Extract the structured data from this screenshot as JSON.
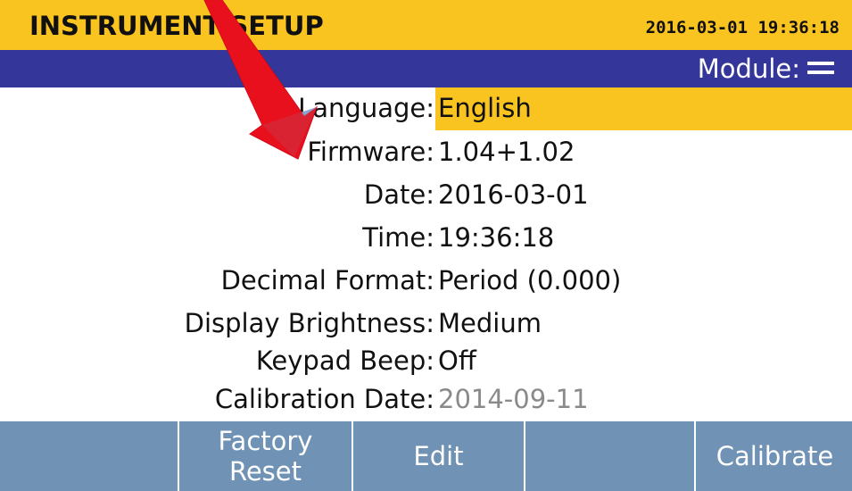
{
  "header": {
    "title": "INSTRUMENT SETUP",
    "datetime": "2016-03-01 19:36:18",
    "module_label": "Module:"
  },
  "settings": [
    {
      "label": "Language:",
      "value": "English",
      "selected": true
    },
    {
      "label": "Firmware:",
      "value": "1.04+1.02"
    },
    {
      "label": "Date:",
      "value": "2016-03-01"
    },
    {
      "label": "Time:",
      "value": "19:36:18"
    },
    {
      "label": "Decimal Format:",
      "value": "Period (0.000)"
    },
    {
      "label": "Display Brightness:",
      "value": "Medium"
    },
    {
      "label": "Keypad Beep:",
      "value": "Off"
    },
    {
      "label": "Calibration Date:",
      "value": "2014-09-11",
      "muted": true
    }
  ],
  "softkeys": {
    "key1": "",
    "key2_line1": "Factory",
    "key2_line2": "Reset",
    "key3": "Edit",
    "key4": "",
    "key5": "Calibrate"
  },
  "colors": {
    "title_bar": "#f9c320",
    "module_bar": "#34369a",
    "selection": "#f9c320",
    "softkey_bar": "#6f92b5",
    "annotation_arrow": "#e8101c"
  },
  "icons": {
    "module_menu": "hamburger-icon",
    "annotation": "red-arrow-annotation"
  }
}
